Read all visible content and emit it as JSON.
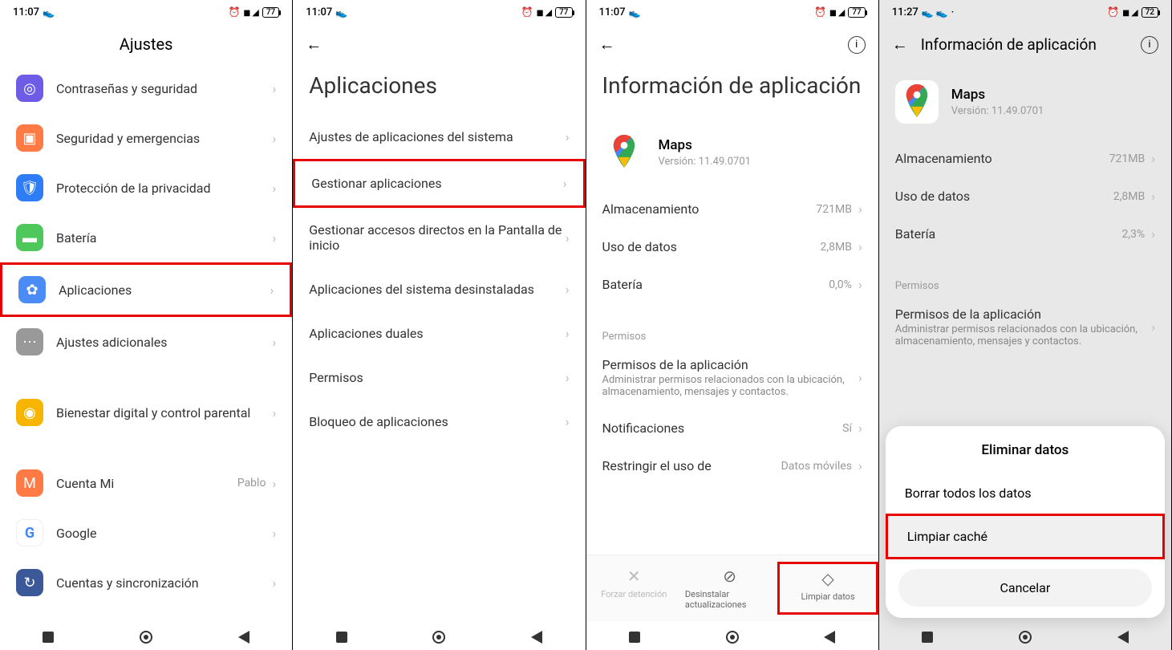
{
  "panel1": {
    "status": {
      "time": "11:07",
      "battery": "77"
    },
    "title": "Ajustes",
    "items": [
      {
        "label": "Contraseñas y seguridad",
        "icon_class": "ic-purple",
        "icon_glyph": "◎"
      },
      {
        "label": "Seguridad y emergencias",
        "icon_class": "ic-orange",
        "icon_glyph": "▣"
      },
      {
        "label": "Protección de la privacidad",
        "icon_class": "ic-blue",
        "icon_glyph": "🛡"
      },
      {
        "label": "Batería",
        "icon_class": "ic-green",
        "icon_glyph": "▬"
      },
      {
        "label": "Aplicaciones",
        "icon_class": "ic-blue2",
        "icon_glyph": "✿",
        "highlight": true
      },
      {
        "label": "Ajustes adicionales",
        "icon_class": "ic-gray",
        "icon_glyph": "⋯"
      }
    ],
    "items2": [
      {
        "label": "Bienestar digital y control parental",
        "icon_class": "ic-yellow",
        "icon_glyph": "◉"
      }
    ],
    "items3": [
      {
        "label": "Cuenta Mi",
        "icon_class": "ic-orange",
        "icon_glyph": "M",
        "value": "Pablo"
      },
      {
        "label": "Google",
        "icon_class": "ic-white",
        "icon_glyph": "G"
      },
      {
        "label": "Cuentas y sincronización",
        "icon_class": "ic-navy",
        "icon_glyph": "↻"
      }
    ]
  },
  "panel2": {
    "status": {
      "time": "11:07",
      "battery": "77"
    },
    "title": "Aplicaciones",
    "items": [
      {
        "label": "Ajustes de aplicaciones del sistema"
      },
      {
        "label": "Gestionar aplicaciones",
        "highlight": true
      },
      {
        "label": "Gestionar accesos directos en la Pantalla de inicio"
      },
      {
        "label": "Aplicaciones del sistema desinstaladas"
      },
      {
        "label": "Aplicaciones duales"
      },
      {
        "label": "Permisos"
      },
      {
        "label": "Bloqueo de aplicaciones"
      }
    ]
  },
  "panel3": {
    "status": {
      "time": "11:07",
      "battery": "77"
    },
    "title": "Información de aplicación",
    "app": {
      "name": "Maps",
      "version": "Versión: 11.49.0701"
    },
    "stats": [
      {
        "label": "Almacenamiento",
        "value": "721MB"
      },
      {
        "label": "Uso de datos",
        "value": "2,8MB"
      },
      {
        "label": "Batería",
        "value": "0,0%"
      }
    ],
    "permisos_header": "Permisos",
    "permisos_label": "Permisos de la aplicación",
    "permisos_sub": "Administrar permisos relacionados con la ubicación, almacenamiento, mensajes y contactos.",
    "notif_label": "Notificaciones",
    "notif_value": "Sí",
    "restrict_label": "Restringir el uso de",
    "restrict_value": "Datos móviles",
    "actions": {
      "force_stop": "Forzar detención",
      "uninstall": "Desinstalar actualizaciones",
      "clear_data": "Limpiar datos"
    }
  },
  "panel4": {
    "status": {
      "time": "11:27",
      "battery": "72"
    },
    "title": "Información de aplicación",
    "app": {
      "name": "Maps",
      "version": "Versión: 11.49.0701"
    },
    "stats": [
      {
        "label": "Almacenamiento",
        "value": "721MB"
      },
      {
        "label": "Uso de datos",
        "value": "2,8MB"
      },
      {
        "label": "Batería",
        "value": "2,3%"
      }
    ],
    "permisos_header": "Permisos",
    "permisos_label": "Permisos de la aplicación",
    "permisos_sub": "Administrar permisos relacionados con la ubicación, almacenamiento, mensajes y contactos.",
    "modal": {
      "title": "Eliminar datos",
      "opt1": "Borrar todos los datos",
      "opt2": "Limpiar caché",
      "cancel": "Cancelar"
    }
  }
}
